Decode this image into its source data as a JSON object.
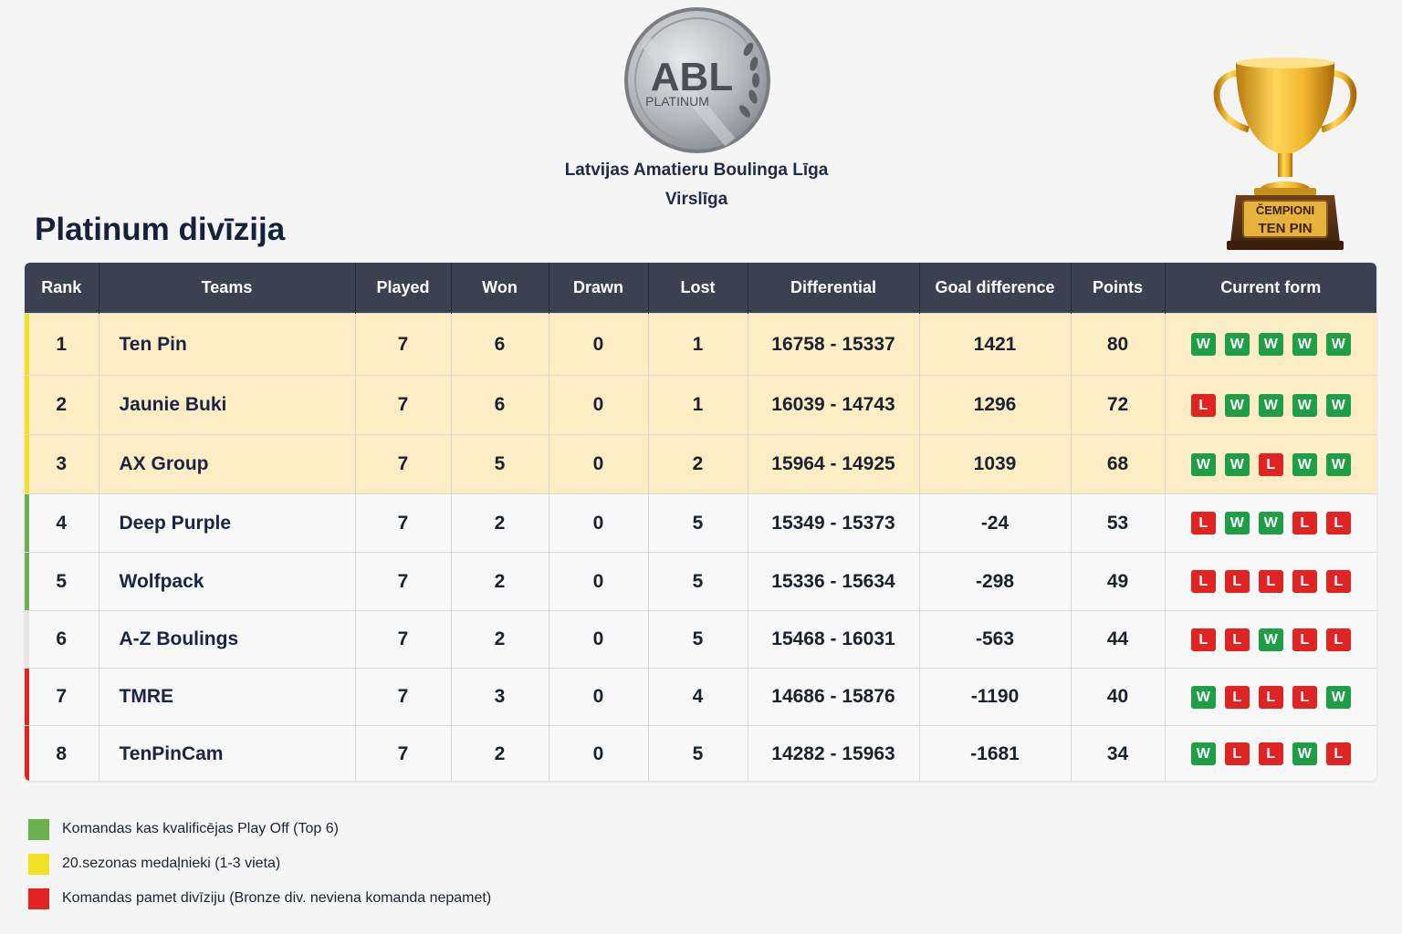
{
  "header": {
    "logo_text": "ABL",
    "logo_subtext": "PLATINUM",
    "league_name": "Latvijas Amatieru Boulinga Līga",
    "league_tier": "Virslīga",
    "page_title": "Platinum divīzija",
    "trophy_line1": "ČEMPIONI",
    "trophy_line2": "TEN PIN"
  },
  "colors": {
    "header_bg": "#3b4150",
    "gold_row_bg": "#fdedc4",
    "zone_medal": "#f2e025",
    "zone_playoff": "#6ab04c",
    "zone_relegation": "#e02424",
    "zone_none": "#e6e6e6",
    "win": "#1e9e45",
    "loss": "#e02424"
  },
  "table": {
    "columns": [
      "Rank",
      "Teams",
      "Played",
      "Won",
      "Drawn",
      "Lost",
      "Differential",
      "Goal difference",
      "Points",
      "Current form"
    ],
    "rows": [
      {
        "rank": "1",
        "team": "Ten Pin",
        "played": "7",
        "won": "6",
        "drawn": "0",
        "lost": "1",
        "differential": "16758 - 15337",
        "goal_difference": "1421",
        "points": "80",
        "form": [
          "W",
          "W",
          "W",
          "W",
          "W"
        ],
        "zone": "medal",
        "highlight": true
      },
      {
        "rank": "2",
        "team": "Jaunie Buki",
        "played": "7",
        "won": "6",
        "drawn": "0",
        "lost": "1",
        "differential": "16039 - 14743",
        "goal_difference": "1296",
        "points": "72",
        "form": [
          "L",
          "W",
          "W",
          "W",
          "W"
        ],
        "zone": "medal",
        "highlight": true
      },
      {
        "rank": "3",
        "team": "AX Group",
        "played": "7",
        "won": "5",
        "drawn": "0",
        "lost": "2",
        "differential": "15964 - 14925",
        "goal_difference": "1039",
        "points": "68",
        "form": [
          "W",
          "W",
          "L",
          "W",
          "W"
        ],
        "zone": "medal",
        "highlight": true
      },
      {
        "rank": "4",
        "team": "Deep Purple",
        "played": "7",
        "won": "2",
        "drawn": "0",
        "lost": "5",
        "differential": "15349 - 15373",
        "goal_difference": "-24",
        "points": "53",
        "form": [
          "L",
          "W",
          "W",
          "L",
          "L"
        ],
        "zone": "playoff",
        "highlight": false
      },
      {
        "rank": "5",
        "team": "Wolfpack",
        "played": "7",
        "won": "2",
        "drawn": "0",
        "lost": "5",
        "differential": "15336 - 15634",
        "goal_difference": "-298",
        "points": "49",
        "form": [
          "L",
          "L",
          "L",
          "L",
          "L"
        ],
        "zone": "playoff",
        "highlight": false
      },
      {
        "rank": "6",
        "team": "A-Z Boulings",
        "played": "7",
        "won": "2",
        "drawn": "0",
        "lost": "5",
        "differential": "15468 - 16031",
        "goal_difference": "-563",
        "points": "44",
        "form": [
          "L",
          "L",
          "W",
          "L",
          "L"
        ],
        "zone": "none",
        "highlight": false
      },
      {
        "rank": "7",
        "team": "TMRE",
        "played": "7",
        "won": "3",
        "drawn": "0",
        "lost": "4",
        "differential": "14686 - 15876",
        "goal_difference": "-1190",
        "points": "40",
        "form": [
          "W",
          "L",
          "L",
          "L",
          "W"
        ],
        "zone": "relegation",
        "highlight": false
      },
      {
        "rank": "8",
        "team": "TenPinCam",
        "played": "7",
        "won": "2",
        "drawn": "0",
        "lost": "5",
        "differential": "14282 - 15963",
        "goal_difference": "-1681",
        "points": "34",
        "form": [
          "W",
          "L",
          "L",
          "W",
          "L"
        ],
        "zone": "relegation",
        "highlight": false
      }
    ]
  },
  "legend": [
    {
      "color": "#6ab04c",
      "text": "Komandas kas kvalificējas Play Off (Top 6)"
    },
    {
      "color": "#f2e025",
      "text": "20.sezonas medaļnieki (1-3 vieta)"
    },
    {
      "color": "#e02424",
      "text": "Komandas pamet divīziju (Bronze div. neviena komanda nepamet)"
    }
  ]
}
